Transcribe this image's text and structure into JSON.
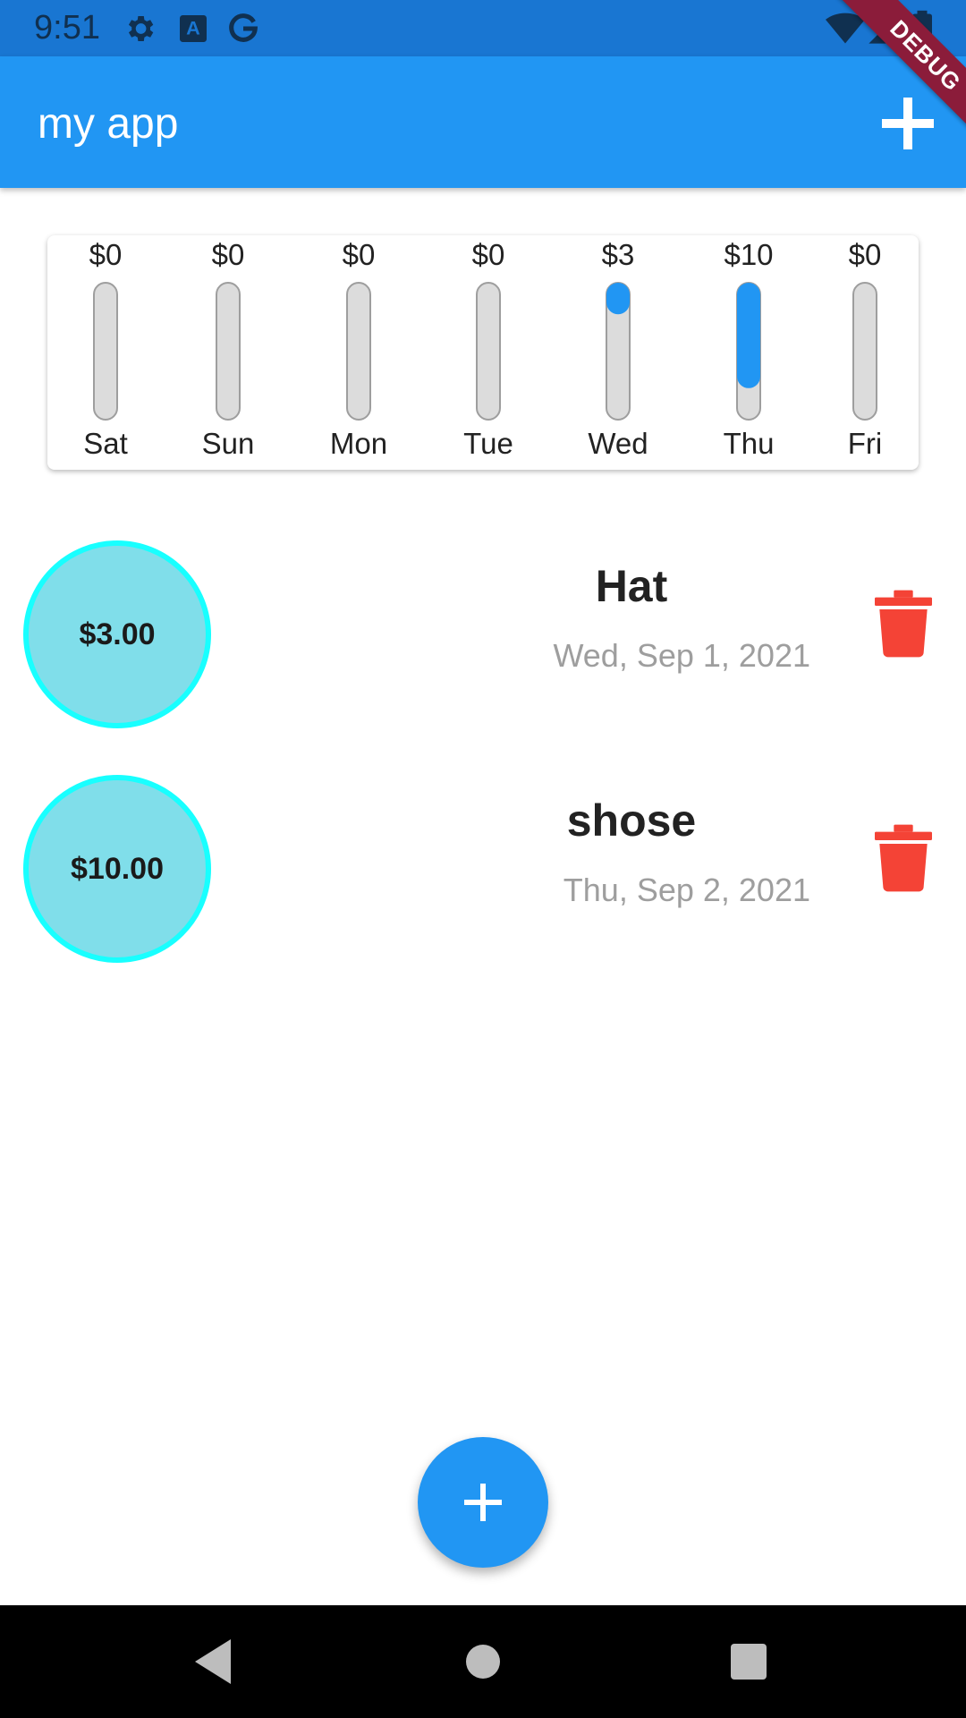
{
  "status_bar": {
    "time": "9:51",
    "icons": [
      "gear-icon",
      "text-a-icon",
      "google-g-icon",
      "wifi-icon",
      "signal-icon",
      "battery-icon"
    ]
  },
  "app_bar": {
    "title": "my app",
    "add_icon": "plus-icon"
  },
  "debug_banner": "DEBUG",
  "chart_data": {
    "type": "bar",
    "categories": [
      "Sat",
      "Sun",
      "Mon",
      "Tue",
      "Wed",
      "Thu",
      "Fri"
    ],
    "values": [
      0,
      0,
      0,
      0,
      3,
      10,
      0
    ],
    "value_labels": [
      "$0",
      "$0",
      "$0",
      "$0",
      "$3",
      "$10",
      "$0"
    ],
    "fill_fraction": [
      0,
      0,
      0,
      0,
      0.23,
      0.77,
      0
    ],
    "colors": {
      "fill": "#2196f3",
      "track": "#dcdcdc",
      "track_border": "#9e9e9e"
    }
  },
  "transactions": [
    {
      "amount": "$3.00",
      "title": "Hat",
      "date": "Wed, Sep 1, 2021"
    },
    {
      "amount": "$10.00",
      "title": "shose",
      "date": "Thu, Sep 2, 2021"
    }
  ],
  "colors": {
    "primary": "#2196f3",
    "status_bar": "#1976d2",
    "circle_fill": "#80deea",
    "circle_border": "#18ffff",
    "delete": "#f44336"
  },
  "fab_icon": "plus-icon",
  "nav_bar": {
    "icons": [
      "back-icon",
      "home-icon",
      "recents-icon"
    ]
  }
}
